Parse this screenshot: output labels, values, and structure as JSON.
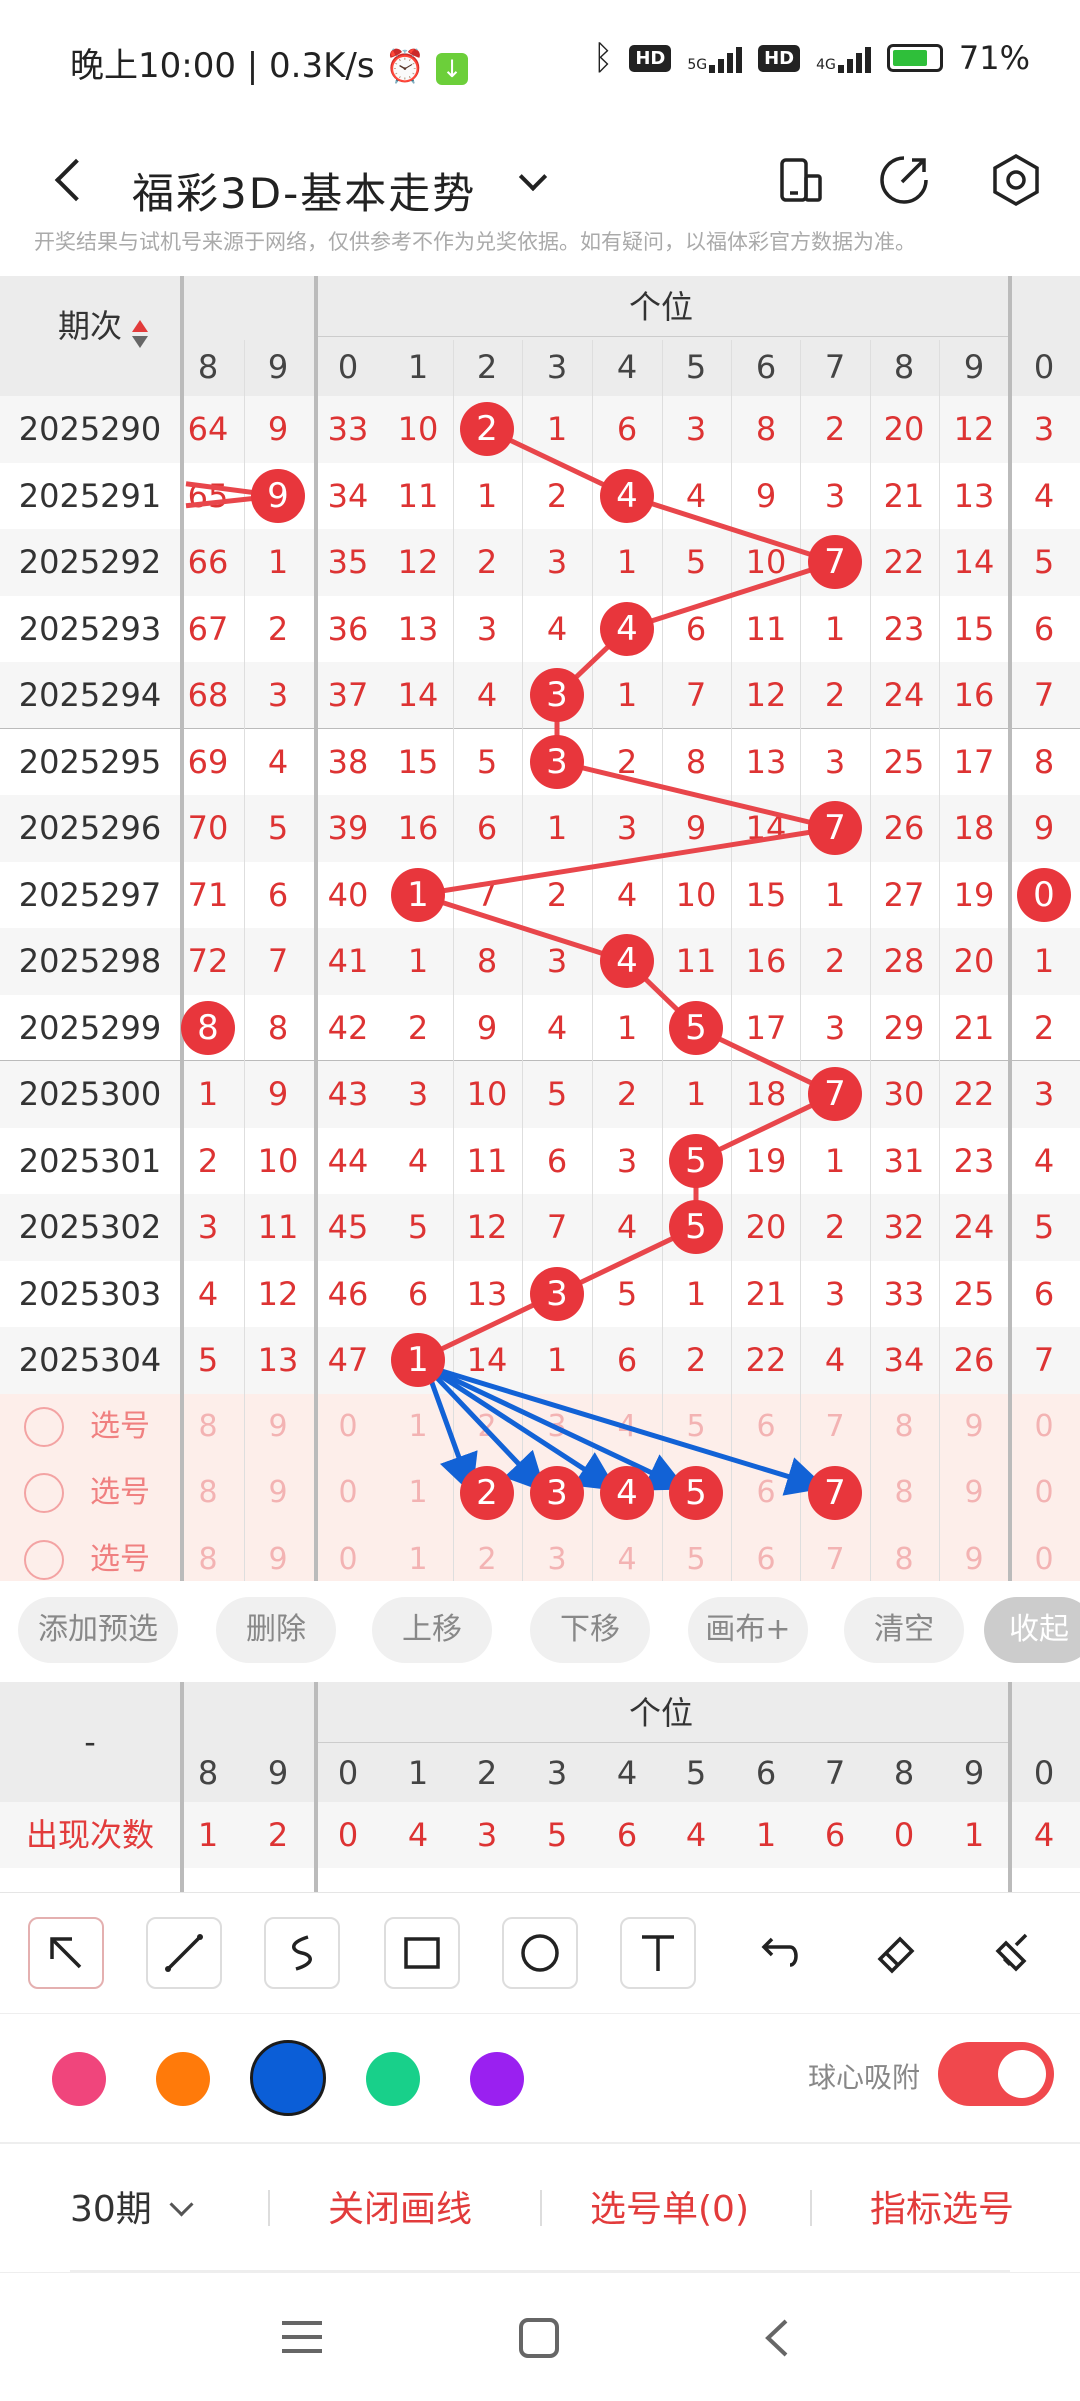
{
  "status": {
    "time_speed": "晚上10:00 | 0.3K/s",
    "net1": "5G",
    "net2": "4G",
    "hd": "HD",
    "battery": "71%"
  },
  "header": {
    "title": "福彩3D-基本走势"
  },
  "notice": "开奖结果与试机号来源于网络，仅供参考不作为兑奖依据。如有疑问，以福体彩官方数据为准。",
  "table": {
    "period_header": "期次",
    "section_header": "个位",
    "col_digits": [
      "8",
      "9",
      "0",
      "1",
      "2",
      "3",
      "4",
      "5",
      "6",
      "7",
      "8",
      "9",
      "0"
    ],
    "rows": [
      {
        "period": "2025290",
        "cells": [
          "64",
          "9",
          "33",
          "10",
          "2",
          "1",
          "6",
          "3",
          "8",
          "2",
          "20",
          "12",
          "3"
        ],
        "ball_col": 4,
        "extra_ball": null
      },
      {
        "period": "2025291",
        "cells": [
          "65",
          "9",
          "34",
          "11",
          "1",
          "2",
          "4",
          "4",
          "9",
          "3",
          "21",
          "13",
          "4"
        ],
        "ball_col": 6,
        "extra_ball": 1
      },
      {
        "period": "2025292",
        "cells": [
          "66",
          "1",
          "35",
          "12",
          "2",
          "3",
          "1",
          "5",
          "10",
          "7",
          "22",
          "14",
          "5"
        ],
        "ball_col": 9,
        "extra_ball": null
      },
      {
        "period": "2025293",
        "cells": [
          "67",
          "2",
          "36",
          "13",
          "3",
          "4",
          "4",
          "6",
          "11",
          "1",
          "23",
          "15",
          "6"
        ],
        "ball_col": 6,
        "extra_ball": null
      },
      {
        "period": "2025294",
        "cells": [
          "68",
          "3",
          "37",
          "14",
          "4",
          "3",
          "1",
          "7",
          "12",
          "2",
          "24",
          "16",
          "7"
        ],
        "ball_col": 5,
        "extra_ball": null
      },
      {
        "period": "2025295",
        "cells": [
          "69",
          "4",
          "38",
          "15",
          "5",
          "3",
          "2",
          "8",
          "13",
          "3",
          "25",
          "17",
          "8"
        ],
        "ball_col": 5,
        "extra_ball": null
      },
      {
        "period": "2025296",
        "cells": [
          "70",
          "5",
          "39",
          "16",
          "6",
          "1",
          "3",
          "9",
          "14",
          "7",
          "26",
          "18",
          "9"
        ],
        "ball_col": 9,
        "extra_ball": null
      },
      {
        "period": "2025297",
        "cells": [
          "71",
          "6",
          "40",
          "1",
          "7",
          "2",
          "4",
          "10",
          "15",
          "1",
          "27",
          "19",
          "0"
        ],
        "ball_col": 3,
        "extra_ball": 12
      },
      {
        "period": "2025298",
        "cells": [
          "72",
          "7",
          "41",
          "1",
          "8",
          "3",
          "4",
          "11",
          "16",
          "2",
          "28",
          "20",
          "1"
        ],
        "ball_col": 6,
        "extra_ball": null
      },
      {
        "period": "2025299",
        "cells": [
          "8",
          "8",
          "42",
          "2",
          "9",
          "4",
          "1",
          "5",
          "17",
          "3",
          "29",
          "21",
          "2"
        ],
        "ball_col": 7,
        "extra_ball": 0
      },
      {
        "period": "2025300",
        "cells": [
          "1",
          "9",
          "43",
          "3",
          "10",
          "5",
          "2",
          "1",
          "18",
          "7",
          "30",
          "22",
          "3"
        ],
        "ball_col": 9,
        "extra_ball": null
      },
      {
        "period": "2025301",
        "cells": [
          "2",
          "10",
          "44",
          "4",
          "11",
          "6",
          "3",
          "5",
          "19",
          "1",
          "31",
          "23",
          "4"
        ],
        "ball_col": 7,
        "extra_ball": null
      },
      {
        "period": "2025302",
        "cells": [
          "3",
          "11",
          "45",
          "5",
          "12",
          "7",
          "4",
          "5",
          "20",
          "2",
          "32",
          "24",
          "5"
        ],
        "ball_col": 7,
        "extra_ball": null
      },
      {
        "period": "2025303",
        "cells": [
          "4",
          "12",
          "46",
          "6",
          "13",
          "3",
          "5",
          "1",
          "21",
          "3",
          "33",
          "25",
          "6"
        ],
        "ball_col": 5,
        "extra_ball": null
      },
      {
        "period": "2025304",
        "cells": [
          "5",
          "13",
          "47",
          "1",
          "14",
          "1",
          "6",
          "2",
          "22",
          "4",
          "34",
          "26",
          "7"
        ],
        "ball_col": 3,
        "extra_ball": null
      }
    ],
    "pick_rows": [
      {
        "label": "选号",
        "cells": [
          "8",
          "9",
          "0",
          "1",
          "2",
          "3",
          "4",
          "5",
          "6",
          "7",
          "8",
          "9",
          "0"
        ],
        "selected": []
      },
      {
        "label": "选号",
        "cells": [
          "8",
          "9",
          "0",
          "1",
          "2",
          "3",
          "4",
          "5",
          "6",
          "7",
          "8",
          "9",
          "0"
        ],
        "selected": [
          4,
          5,
          6,
          7,
          9
        ]
      },
      {
        "label": "选号",
        "cells": [
          "8",
          "9",
          "0",
          "1",
          "2",
          "3",
          "4",
          "5",
          "6",
          "7",
          "8",
          "9",
          "0"
        ],
        "selected": []
      }
    ]
  },
  "actions": {
    "add_preselect": "添加预选",
    "delete": "删除",
    "move_up": "上移",
    "move_down": "下移",
    "canvas_plus": "画布+",
    "clear": "清空",
    "collapse": "收起"
  },
  "stats": {
    "period_header": "-",
    "section_header": "个位",
    "col_digits": [
      "8",
      "9",
      "0",
      "1",
      "2",
      "3",
      "4",
      "5",
      "6",
      "7",
      "8",
      "9",
      "0"
    ],
    "row_label": "出现次数",
    "counts": [
      "1",
      "2",
      "0",
      "4",
      "3",
      "5",
      "6",
      "4",
      "1",
      "6",
      "0",
      "1",
      "4"
    ]
  },
  "draw_tools": [
    "pointer-arrow",
    "line",
    "curve",
    "rectangle",
    "circle",
    "text",
    "undo",
    "eraser",
    "clear-all"
  ],
  "palette": [
    "#f0457c",
    "#ff7a0a",
    "#0b5ed7",
    "#18d08a",
    "#9a20f0"
  ],
  "snap": {
    "label": "球心吸附",
    "on": true
  },
  "bottom": {
    "periods": "30期",
    "close_lines": "关闭画线",
    "pick_list": "选号单(0)",
    "indicator_pick": "指标选号"
  }
}
